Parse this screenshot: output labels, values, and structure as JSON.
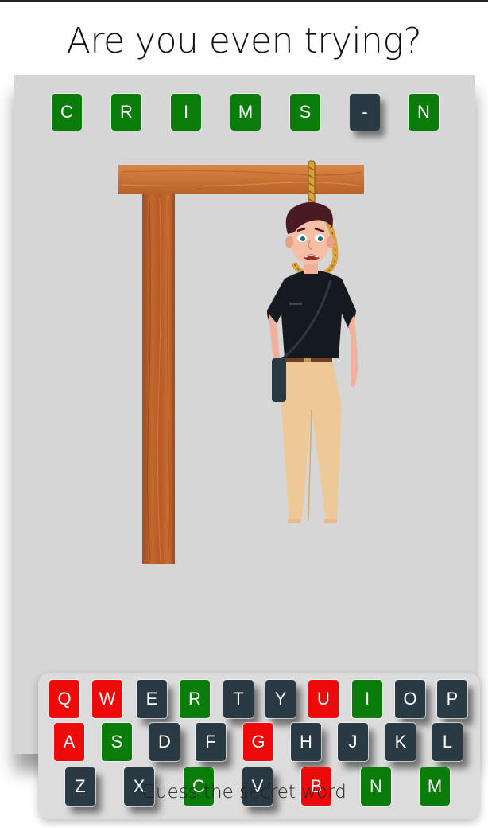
{
  "title": "Are you even trying?",
  "footer": "Guess the secret word",
  "word_tiles": [
    {
      "letter": "C",
      "state": "revealed"
    },
    {
      "letter": "R",
      "state": "revealed"
    },
    {
      "letter": "I",
      "state": "revealed"
    },
    {
      "letter": "M",
      "state": "revealed"
    },
    {
      "letter": "S",
      "state": "revealed"
    },
    {
      "letter": "-",
      "state": "hidden"
    },
    {
      "letter": "N",
      "state": "revealed"
    }
  ],
  "keyboard": {
    "rows": [
      [
        {
          "letter": "Q",
          "state": "wrong"
        },
        {
          "letter": "W",
          "state": "wrong"
        },
        {
          "letter": "E",
          "state": "unused"
        },
        {
          "letter": "R",
          "state": "correct"
        },
        {
          "letter": "T",
          "state": "unused"
        },
        {
          "letter": "Y",
          "state": "unused"
        },
        {
          "letter": "U",
          "state": "wrong"
        },
        {
          "letter": "I",
          "state": "correct"
        },
        {
          "letter": "O",
          "state": "unused"
        },
        {
          "letter": "P",
          "state": "unused"
        }
      ],
      [
        {
          "letter": "A",
          "state": "wrong"
        },
        {
          "letter": "S",
          "state": "correct"
        },
        {
          "letter": "D",
          "state": "unused"
        },
        {
          "letter": "F",
          "state": "unused"
        },
        {
          "letter": "G",
          "state": "wrong"
        },
        {
          "letter": "H",
          "state": "unused"
        },
        {
          "letter": "J",
          "state": "unused"
        },
        {
          "letter": "K",
          "state": "unused"
        },
        {
          "letter": "L",
          "state": "unused"
        }
      ],
      [
        {
          "letter": "Z",
          "state": "unused"
        },
        {
          "letter": "X",
          "state": "unused"
        },
        {
          "letter": "C",
          "state": "correct"
        },
        {
          "letter": "V",
          "state": "unused"
        },
        {
          "letter": "B",
          "state": "wrong"
        },
        {
          "letter": "N",
          "state": "correct"
        },
        {
          "letter": "M",
          "state": "correct"
        }
      ]
    ]
  },
  "colors": {
    "correct": "#0a7c0a",
    "wrong": "#ee0a0a",
    "unused": "#2a3a44",
    "board": "#d6d6d6"
  }
}
